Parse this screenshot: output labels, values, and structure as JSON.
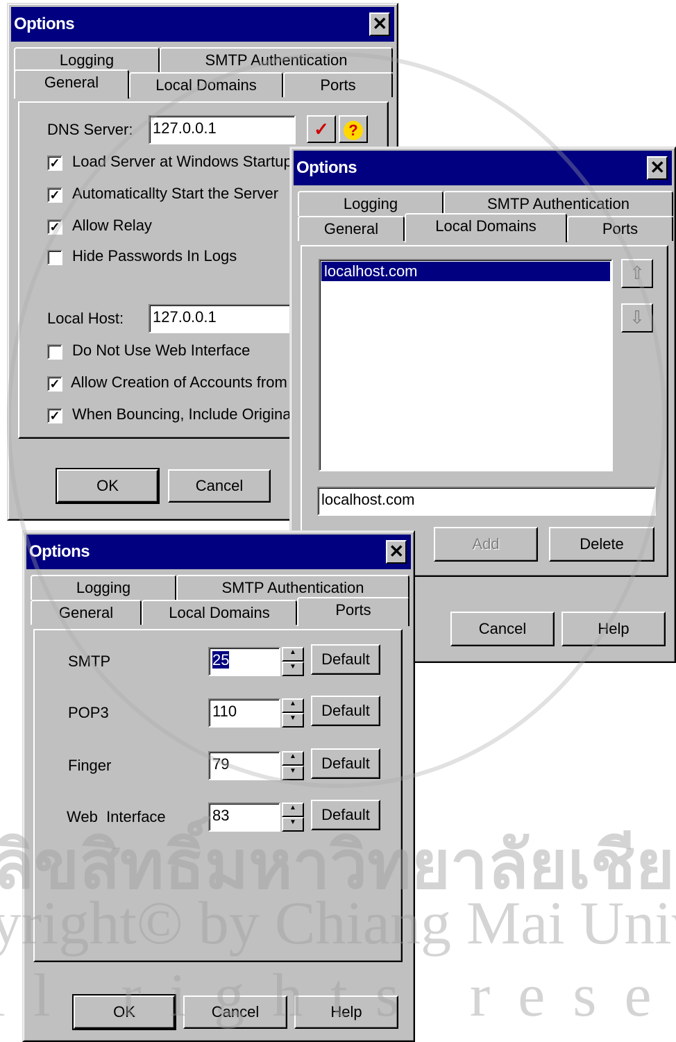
{
  "dialog1": {
    "title": "Options",
    "close": "✕",
    "tabs": {
      "logging": "Logging",
      "smtp_auth": "SMTP Authentication",
      "general": "General",
      "local_domains": "Local Domains",
      "ports": "Ports"
    },
    "active_tab": "General",
    "dns_label": "DNS Server:",
    "dns_value": "127.0.0.1",
    "checks": [
      {
        "label": "Load Server at Windows Startup",
        "checked": true
      },
      {
        "label": "Automaticallty Start the Server",
        "checked": true
      },
      {
        "label": "Allow Relay",
        "checked": true
      },
      {
        "label": "Hide Passwords In Logs",
        "checked": false
      }
    ],
    "localhost_label": "Local Host:",
    "localhost_value": "127.0.0.1",
    "checks2": [
      {
        "label": "Do Not Use Web Interface",
        "checked": false
      },
      {
        "label": "Allow Creation of Accounts from V",
        "checked": true
      },
      {
        "label": "When Bouncing, Include Original",
        "checked": true
      }
    ],
    "ok": "OK",
    "cancel": "Cancel"
  },
  "dialog2": {
    "title": "Options",
    "close": "✕",
    "tabs": {
      "logging": "Logging",
      "smtp_auth": "SMTP Authentication",
      "general": "General",
      "local_domains": "Local Domains",
      "ports": "Ports"
    },
    "active_tab": "Local Domains",
    "list_items": [
      "localhost.com"
    ],
    "domain_input": "localhost.com",
    "add": "Add",
    "delete": "Delete",
    "cancel": "Cancel",
    "help": "Help"
  },
  "dialog3": {
    "title": "Options",
    "close": "✕",
    "tabs": {
      "logging": "Logging",
      "smtp_auth": "SMTP Authentication",
      "general": "General",
      "local_domains": "Local Domains",
      "ports": "Ports"
    },
    "active_tab": "Ports",
    "ports": [
      {
        "label": "SMTP",
        "value": "25",
        "default": "Default"
      },
      {
        "label": "POP3",
        "value": "110",
        "default": "Default"
      },
      {
        "label": "Finger",
        "value": "79",
        "default": "Default"
      },
      {
        "label": "Web  Interface",
        "value": "83",
        "default": "Default"
      }
    ],
    "ok": "OK",
    "cancel": "Cancel",
    "help": "Help"
  },
  "watermark": {
    "thai": "ลิขสิทธิ์มหาวิทยาลัยเชียงใหม่",
    "copyright": "Copyright© by Chiang Mai University",
    "rights": "All rights reserved"
  }
}
